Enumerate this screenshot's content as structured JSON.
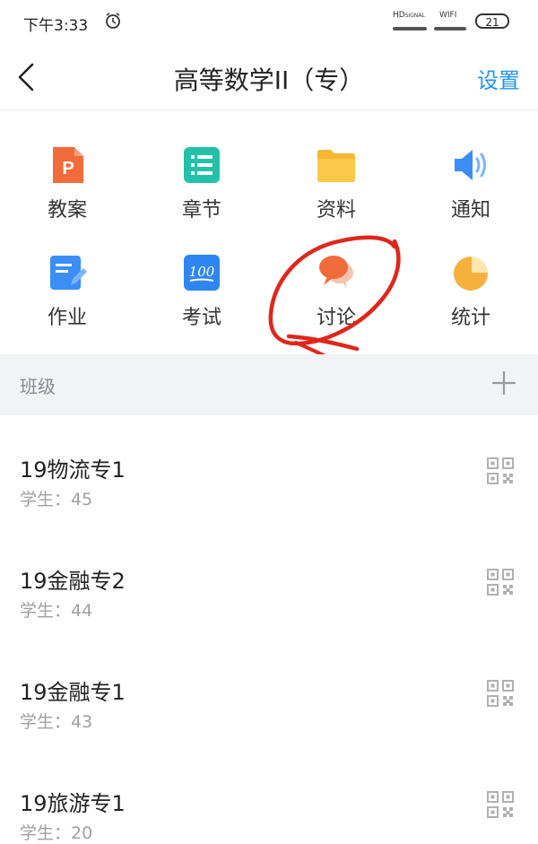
{
  "status_bar": {
    "time": "下午3:33",
    "signal_label": "HD",
    "signal_sub": "SIGNAL",
    "wifi_label": "WIFI",
    "battery": "21"
  },
  "header": {
    "title": "高等数学II（专）",
    "settings_label": "设置",
    "accent": "#2196f3"
  },
  "features": [
    {
      "label": "教案",
      "icon": "ppt-icon"
    },
    {
      "label": "章节",
      "icon": "chapter-list-icon"
    },
    {
      "label": "资料",
      "icon": "folder-icon"
    },
    {
      "label": "通知",
      "icon": "speaker-icon"
    },
    {
      "label": "作业",
      "icon": "homework-icon"
    },
    {
      "label": "考试",
      "icon": "exam-100-icon"
    },
    {
      "label": "讨论",
      "icon": "discussion-bubbles-icon"
    },
    {
      "label": "统计",
      "icon": "pie-chart-icon"
    }
  ],
  "section": {
    "label": "班级",
    "add_icon": "plus-icon"
  },
  "classes": [
    {
      "name": "19物流专1",
      "students": "学生：45"
    },
    {
      "name": "19金融专2",
      "students": "学生：44"
    },
    {
      "name": "19金融专1",
      "students": "学生：43"
    },
    {
      "name": "19旅游专1",
      "students": "学生：20"
    }
  ],
  "annotation_color": "#e0261b"
}
